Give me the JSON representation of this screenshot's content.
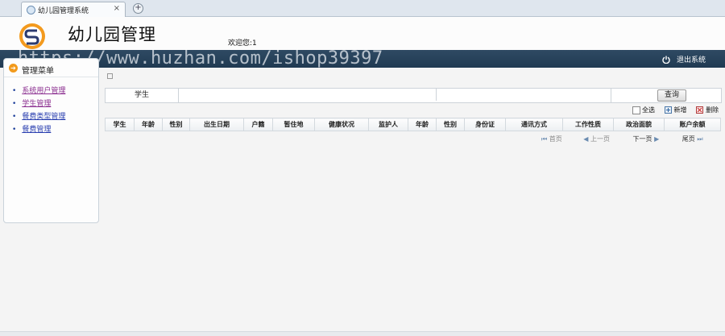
{
  "browser": {
    "tab_title": "幼儿园管理系统",
    "tab_close": "×",
    "new_tab": "+"
  },
  "header": {
    "app_title": "幼儿园管理",
    "welcome": "欢迎您:1",
    "logout_label": "退出系统"
  },
  "watermark": "https://www.huzhan.com/ishop39397",
  "sidebar": {
    "title": "管理菜单",
    "items": [
      {
        "label": "系统用户管理"
      },
      {
        "label": "学生管理"
      },
      {
        "label": "餐费类型管理"
      },
      {
        "label": "餐费管理"
      }
    ]
  },
  "search": {
    "label": "学生",
    "value": "",
    "button": "查询"
  },
  "toolbar": {
    "select_all": "全选",
    "add": "新增",
    "delete": "删除"
  },
  "table": {
    "columns": [
      "学生",
      "年龄",
      "性别",
      "出生日期",
      "户籍",
      "暂住地",
      "健康状况",
      "监护人",
      "年龄",
      "性别",
      "身份证",
      "通讯方式",
      "工作性质",
      "政治面貌",
      "账户余额"
    ],
    "rows": []
  },
  "pager": {
    "first": "首页",
    "prev": "上一页",
    "next": "下一页",
    "last": "尾页"
  },
  "colors": {
    "navbar": "#24405a",
    "accent_orange": "#f29a1c",
    "link": "#2a3fb0"
  }
}
